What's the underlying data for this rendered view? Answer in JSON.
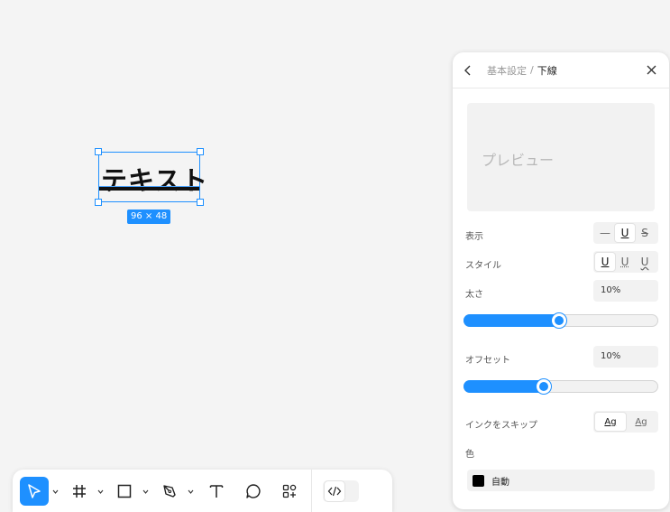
{
  "canvas": {
    "text": "テキスト",
    "size_badge": "96 × 48"
  },
  "panel": {
    "breadcrumb_parent": "基本設定",
    "breadcrumb_sep": "/",
    "title": "下線",
    "preview_text": "プレビュー",
    "display": {
      "label": "表示",
      "options": [
        "—",
        "U",
        "S"
      ],
      "selected": "U"
    },
    "style": {
      "label": "スタイル",
      "options": [
        "U",
        "U",
        "U"
      ],
      "selected": 0
    },
    "thickness": {
      "label": "太さ",
      "value": "10%",
      "slider_fraction": 0.49
    },
    "offset": {
      "label": "オフセット",
      "value": "10%",
      "slider_fraction": 0.41
    },
    "skip_ink": {
      "label": "インクをスキップ",
      "options": [
        "Ag",
        "Ag"
      ],
      "selected": 0
    },
    "color": {
      "label": "色",
      "value": "自動",
      "swatch": "#000000"
    }
  },
  "colors": {
    "accent": "#1e90ff"
  },
  "toolbar": {
    "tools": [
      "pointer-icon",
      "frame-icon",
      "rectangle-icon",
      "pen-icon",
      "text-icon",
      "comment-icon",
      "components-icon"
    ],
    "active": "pointer-icon"
  }
}
